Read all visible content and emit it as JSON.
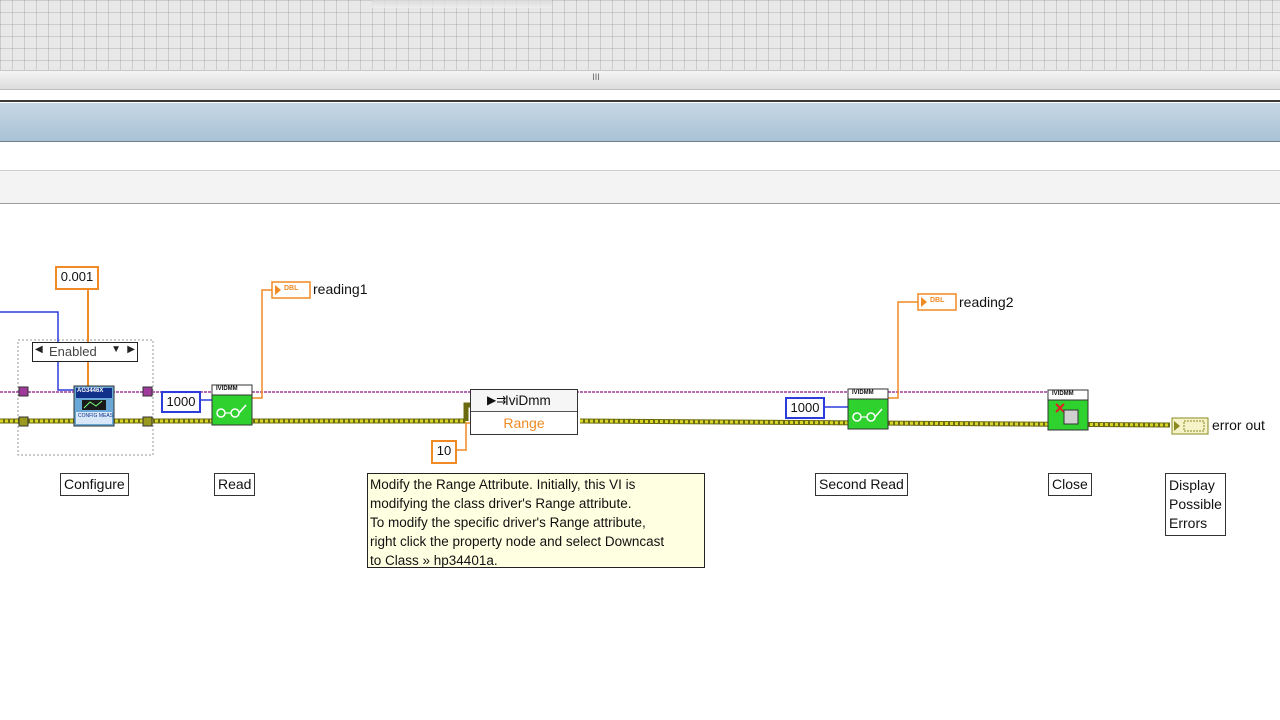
{
  "front_panel": {
    "splitter_grip": "III"
  },
  "constants": {
    "resolution": "0.001",
    "enum_value": "Enabled",
    "max_time_1": "1000",
    "max_time_2": "1000",
    "range_value": "10"
  },
  "property_node": {
    "class": "IviDmm",
    "property": "Range"
  },
  "indicators": {
    "reading1": "reading1",
    "reading2": "reading2",
    "error_out": "error out",
    "dbl_type": "DBL"
  },
  "subvi_icons": {
    "configure": "AG3446X",
    "configure_sub": "CONFIG MEAS",
    "ividmm": "IVIDMM"
  },
  "step_labels": {
    "configure": "Configure",
    "read": "Read",
    "second_read": "Second Read",
    "close": "Close",
    "display_errors": [
      "Display",
      "Possible",
      "Errors"
    ]
  },
  "comment": [
    "Modify the Range Attribute. Initially, this VI is",
    "modifying the class driver's Range attribute.",
    "To modify the specific driver's Range attribute,",
    "right click the property node and select Downcast",
    "to Class » hp34401a."
  ],
  "colors": {
    "error_wire": "#c9c61a",
    "refnum_wire": "#a03a9a",
    "numeric_wire": "#f08a24",
    "int_wire": "#2d3ddc",
    "subvi_green": "#2fd12f"
  }
}
